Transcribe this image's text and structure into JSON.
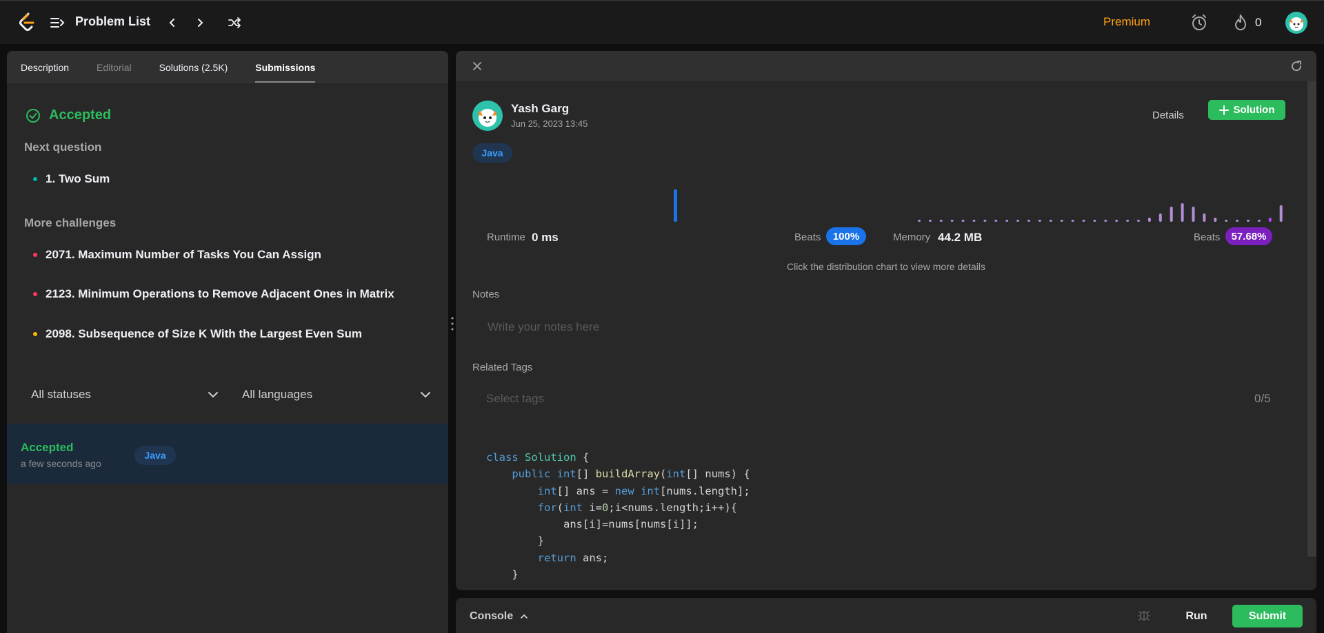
{
  "topbar": {
    "title": "Problem List",
    "premium": "Premium",
    "streak_count": "0",
    "icons": [
      "leetcode-logo-icon",
      "list-icon",
      "chevron-left-icon",
      "chevron-right-icon",
      "shuffle-icon",
      "alarm-icon",
      "fire-icon",
      "avatar"
    ]
  },
  "left": {
    "tabs": [
      "Description",
      "Editorial",
      "Solutions (2.5K)",
      "Submissions"
    ],
    "active_tab": "Submissions",
    "accepted": "Accepted",
    "next_question_label": "Next question",
    "next_question": {
      "title": "1. Two Sum",
      "color": "#00b8a3"
    },
    "more_challenges_label": "More challenges",
    "challenges": [
      {
        "title": "2071. Maximum Number of Tasks You Can Assign",
        "color": "#ff375f"
      },
      {
        "title": "2123. Minimum Operations to Remove Adjacent Ones in Matrix",
        "color": "#ff375f"
      },
      {
        "title": "2098. Subsequence of Size K With the Largest Even Sum",
        "color": "#ffb800"
      }
    ],
    "filters": {
      "status": "All statuses",
      "language": "All languages"
    },
    "submission": {
      "status": "Accepted",
      "time": "a few seconds ago",
      "language": "Java"
    }
  },
  "right": {
    "user": {
      "name": "Yash Garg",
      "date": "Jun 25, 2023 13:45"
    },
    "details": "Details",
    "solution_button": "Solution",
    "language": "Java",
    "runtime": {
      "label": "Runtime",
      "value": "0 ms",
      "beats_label": "Beats",
      "beats": "100%"
    },
    "memory": {
      "label": "Memory",
      "value": "44.2 MB",
      "beats_label": "Beats",
      "beats": "57.68%"
    },
    "hint": "Click the distribution chart to view more details",
    "notes_label": "Notes",
    "notes_placeholder": "Write your notes here",
    "tags_label": "Related Tags",
    "tags_placeholder": "Select tags",
    "tags_count": "0/5",
    "code": {
      "l1": {
        "kw": "class",
        "cls": "Solution",
        "rest": " {"
      },
      "l2": {
        "kw1": "public",
        "kw2": "int",
        "fn": "buildArray",
        "kw3": "int",
        "rest": "[] nums) {"
      },
      "l3": {
        "kw1": "int",
        "mid": "[] ans = ",
        "kw2": "new",
        "kw3": "int",
        "rest": "[nums.length];"
      },
      "l4": {
        "kw1": "for",
        "kw2": "int",
        "num": "0",
        "rest": ";i<nums.length;i++){"
      },
      "l5": "ans[i]=nums[nums[i]];",
      "l6": "}",
      "l7": {
        "kw": "return",
        "rest": " ans;"
      },
      "l8": "}"
    }
  },
  "console": {
    "label": "Console",
    "run": "Run",
    "submit": "Submit"
  },
  "colors": {
    "accent_green": "#2cbb5d",
    "premium": "#ffa116",
    "runtime_pill": "#1a73e8",
    "memory_pill": "#7c1fbf"
  }
}
